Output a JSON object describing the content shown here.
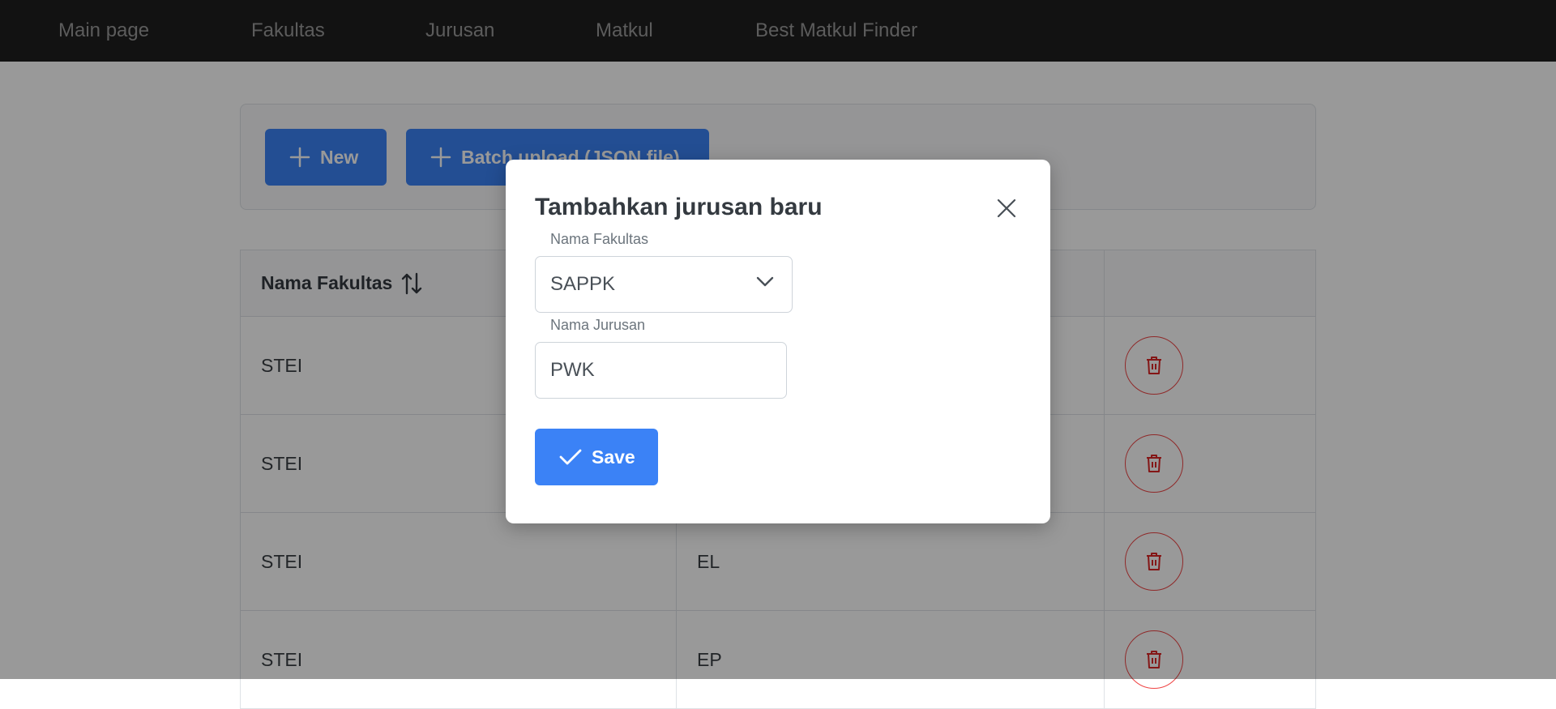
{
  "nav": {
    "items": [
      "Main page",
      "Fakultas",
      "Jurusan",
      "Matkul",
      "Best Matkul Finder"
    ]
  },
  "toolbar": {
    "new_label": "New",
    "batch_label": "Batch upload (JSON file)"
  },
  "table": {
    "headers": [
      "Nama Fakultas",
      "",
      ""
    ],
    "rows": [
      {
        "fakultas": "STEI",
        "jurusan": ""
      },
      {
        "fakultas": "STEI",
        "jurusan": ""
      },
      {
        "fakultas": "STEI",
        "jurusan": "EL"
      },
      {
        "fakultas": "STEI",
        "jurusan": "EP"
      }
    ]
  },
  "modal": {
    "title": "Tambahkan jurusan baru",
    "fakultas_label": "Nama Fakultas",
    "fakultas_value": "SAPPK",
    "jurusan_label": "Nama Jurusan",
    "jurusan_value": "PWK",
    "save_label": "Save"
  },
  "colors": {
    "primary": "#3b82f6",
    "danger": "#ef4444",
    "nav_bg": "#1e1e1e"
  },
  "icons": {
    "add": "plus-icon",
    "sort": "sort-icon",
    "delete": "trash-icon",
    "close": "close-icon",
    "dropdown": "chevron-down-icon",
    "save": "check-icon"
  }
}
